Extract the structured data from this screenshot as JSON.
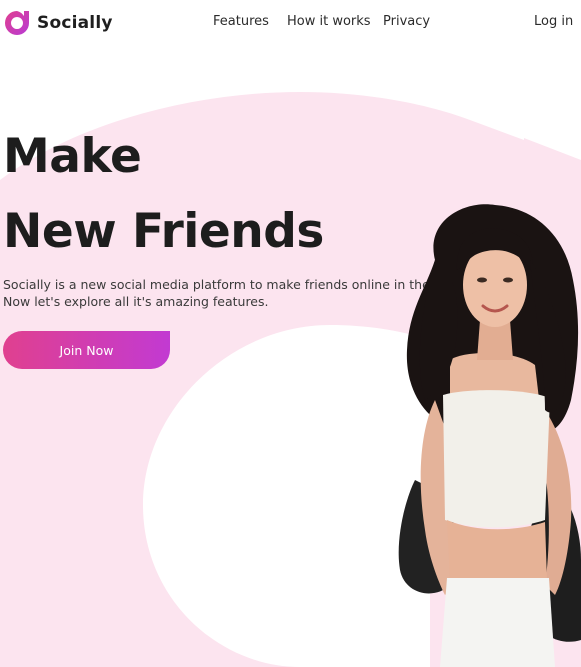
{
  "brand": {
    "name": "Socially",
    "accent_gradient": [
      "#e0408f",
      "#c23ad2"
    ],
    "logo_icon": "socially-logo-icon"
  },
  "nav": {
    "items": [
      {
        "label": "Features"
      },
      {
        "label": "How it works"
      },
      {
        "label": "Privacy"
      }
    ],
    "login_label": "Log in"
  },
  "hero": {
    "headline_line1": "Make",
    "headline_line2": "New Friends",
    "subtitle_line1": "Socially is a new social media platform to make friends online in the world.",
    "subtitle_line2": "Now let's explore all it's amazing features.",
    "cta_label": "Join Now",
    "background_color": "#fce4ef",
    "photo": "woman-portrait-image"
  }
}
